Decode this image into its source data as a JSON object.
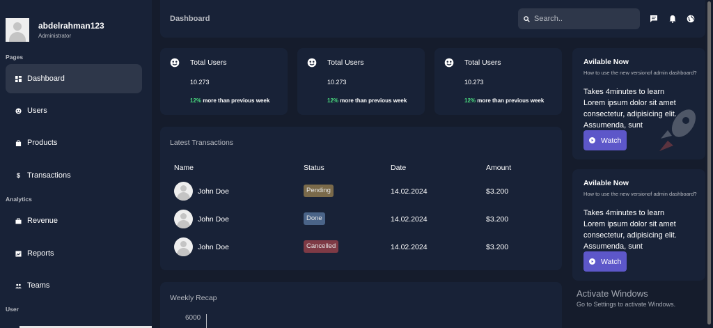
{
  "user": {
    "name": "abdelrahman123",
    "role": "Administrator"
  },
  "sidebar": {
    "sections": [
      "Pages",
      "Analytics",
      "User"
    ],
    "items": [
      {
        "label": "Dashboard",
        "icon": "dashboard-icon",
        "active": true
      },
      {
        "label": "Users",
        "icon": "users-icon",
        "active": false
      },
      {
        "label": "Products",
        "icon": "shopping-bag-icon",
        "active": false
      },
      {
        "label": "Transactions",
        "icon": "dollar-icon",
        "active": false
      },
      {
        "label": "Revenue",
        "icon": "briefcase-icon",
        "active": false
      },
      {
        "label": "Reports",
        "icon": "report-icon",
        "active": false
      },
      {
        "label": "Teams",
        "icon": "teams-icon",
        "active": false
      }
    ]
  },
  "topbar": {
    "title": "Dashboard",
    "search_placeholder": "Search..",
    "icons": [
      "chat-icon",
      "bell-icon",
      "globe-icon"
    ]
  },
  "stats": [
    {
      "title": "Total Users",
      "value": "10.273",
      "pct": "12%",
      "detail": "more than previous week"
    },
    {
      "title": "Total Users",
      "value": "10.273",
      "pct": "12%",
      "detail": "more than previous week"
    },
    {
      "title": "Total Users",
      "value": "10.273",
      "pct": "12%",
      "detail": "more than previous week"
    }
  ],
  "transactions": {
    "title": "Latest Transactions",
    "headers": [
      "Name",
      "Status",
      "Date",
      "Amount"
    ],
    "rows": [
      {
        "name": "John Doe",
        "status": "Pending",
        "status_color": "#7a6a4a",
        "date": "14.02.2024",
        "amount": "$3.200"
      },
      {
        "name": "John Doe",
        "status": "Done",
        "status_color": "#4a6488",
        "date": "14.02.2024",
        "amount": "$3.200"
      },
      {
        "name": "John Doe",
        "status": "Cancelled",
        "status_color": "#7e3a45",
        "date": "14.02.2024",
        "amount": "$3.200"
      }
    ]
  },
  "recap": {
    "title": "Weekly Recap",
    "tick": "6000"
  },
  "promos": [
    {
      "title": "Avilable Now",
      "subtitle": "How to use the new versionof admin dashboard?",
      "text": "Takes 4minutes to learn Lorem ipsum dolor sit amet consectetur, adipisicing elit. Assumenda, sunt",
      "button": "Watch"
    },
    {
      "title": "Avilable Now",
      "subtitle": "How to use the new versionof admin dashboard?",
      "text": "Takes 4minutes to learn Lorem ipsum dolor sit amet consectetur, adipisicing elit. Assumenda, sunt",
      "button": "Watch"
    }
  ],
  "activate_windows": {
    "title": "Activate Windows",
    "subtitle": "Go to Settings to activate Windows."
  },
  "colors": {
    "background": "#151c2c",
    "panel": "#182237",
    "active": "#2e374a",
    "accent_green": "#4ade80",
    "button_purple": "#5d57c9"
  }
}
